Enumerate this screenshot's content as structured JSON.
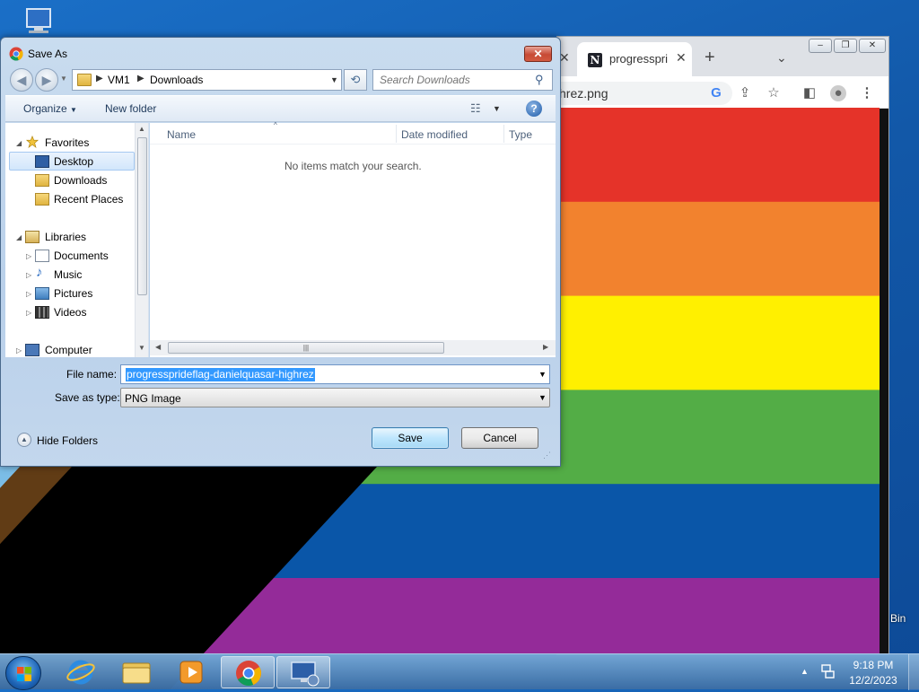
{
  "desktop": {
    "recycle_bin_label_fragment": "Bin"
  },
  "chrome": {
    "tab_title": "progresspri",
    "tab_close": "✕",
    "prev_tab_close": "✕",
    "new_tab": "+",
    "tab_list": "⌄",
    "url_fragment": "hrez.png",
    "flag_colors": [
      "#e53329",
      "#f2822e",
      "#fff000",
      "#53ad46",
      "#0a56a8",
      "#942b99"
    ],
    "chevron_colors": [
      "#ffffff",
      "#f4a9c8",
      "#7bbde6",
      "#613c15",
      "#000000"
    ]
  },
  "dialog": {
    "title": "Save As",
    "close": "✕",
    "breadcrumb": [
      "VM1",
      "Downloads"
    ],
    "search_placeholder": "Search Downloads",
    "toolbar": {
      "organize": "Organize",
      "new_folder": "New folder"
    },
    "nav_tree": {
      "favorites": "Favorites",
      "desktop": "Desktop",
      "downloads": "Downloads",
      "recent_places": "Recent Places",
      "libraries": "Libraries",
      "documents": "Documents",
      "music": "Music",
      "pictures": "Pictures",
      "videos": "Videos",
      "computer": "Computer"
    },
    "columns": {
      "name": "Name",
      "date_modified": "Date modified",
      "type": "Type"
    },
    "empty_message": "No items match your search.",
    "file_name_label": "File name:",
    "file_name_value": "progressprideflag-danielquasar-highrez",
    "save_as_type_label": "Save as type:",
    "save_as_type_value": "PNG Image",
    "hide_folders": "Hide Folders",
    "save": "Save",
    "cancel": "Cancel"
  },
  "taskbar": {
    "time": "9:18 PM",
    "date": "12/2/2023"
  }
}
